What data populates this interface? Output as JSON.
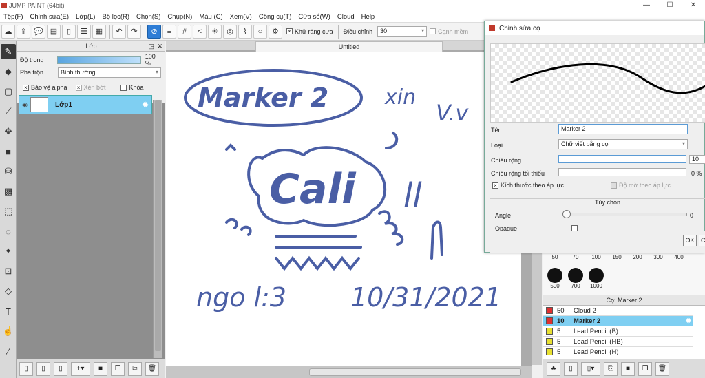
{
  "window": {
    "title": "JUMP PAINT (64bit)",
    "min": "—",
    "max": "☐",
    "close": "✕"
  },
  "menu": [
    "Tệp(F)",
    "Chỉnh sửa(E)",
    "Lớp(L)",
    "Bộ lọc(R)",
    "Chọn(S)",
    "Chụp(N)",
    "Màu (C)",
    "Xem(V)",
    "Công cụ(T)",
    "Cửa sổ(W)",
    "Cloud",
    "Help"
  ],
  "toolbar": {
    "antialias_label": "Khử răng cưa",
    "antialias_checked": true,
    "adjust_label": "Điều chỉnh",
    "adjust_value": "30",
    "snap_label": "Cạnh mềm"
  },
  "layer_panel": {
    "title": "Lớp",
    "opacity_label": "Độ trong",
    "opacity_value": "100 %",
    "opacity_level": 1.0,
    "blend_label": "Pha trộn",
    "blend_value": "Bình thường",
    "protect_alpha_label": "Bảo vệ alpha",
    "clip_label": "Xén bớt",
    "lock_label": "Khóa",
    "layer_name": "Lớp1"
  },
  "document": {
    "tab_title": "Untitled"
  },
  "canvas_text": {
    "marker": "Marker 2",
    "xin": "xin",
    "vuu": "V.v",
    "cali": "Cali",
    "bb": "ll",
    "ngo": "ngo l:3",
    "date": "10/31/2021"
  },
  "brush_dialog": {
    "title": "Chỉnh sửa cọ",
    "name_label": "Tên",
    "name_value": "Marker 2",
    "type_label": "Loại",
    "type_value": "Chữ viết bằng cọ",
    "width_label": "Chiều rộng",
    "width_value": "10",
    "min_width_label": "Chiều rộng tối thiểu",
    "min_width_value": "0 %",
    "size_pressure_label": "Kích thước theo áp lực",
    "opacity_pressure_label": "Độ mờ theo áp lực",
    "options_label": "Tùy chọn",
    "angle_label": "Angle",
    "angle_value": "0",
    "opaque_label": "Opaque",
    "ok_label": "OK",
    "cancel_label": "C"
  },
  "brush_sizes": [
    "50",
    "70",
    "100",
    "150",
    "200",
    "300",
    "400",
    "500",
    "700",
    "1000"
  ],
  "brush_list": {
    "title": "Cọ: Marker 2",
    "items": [
      {
        "size": "50",
        "name": "Cloud 2",
        "color": "#e03030"
      },
      {
        "size": "10",
        "name": "Marker 2",
        "color": "#e03030"
      },
      {
        "size": "5",
        "name": "Lead Pencil (B)",
        "color": "#e8e030"
      },
      {
        "size": "5",
        "name": "Lead Pencil (HB)",
        "color": "#e8e030"
      },
      {
        "size": "5",
        "name": "Lead Pencil (H)",
        "color": "#e8e030"
      }
    ]
  },
  "colors": {
    "ink": "#4a5ea5",
    "accent": "#2e7dd6",
    "selection": "#7fcff2"
  }
}
